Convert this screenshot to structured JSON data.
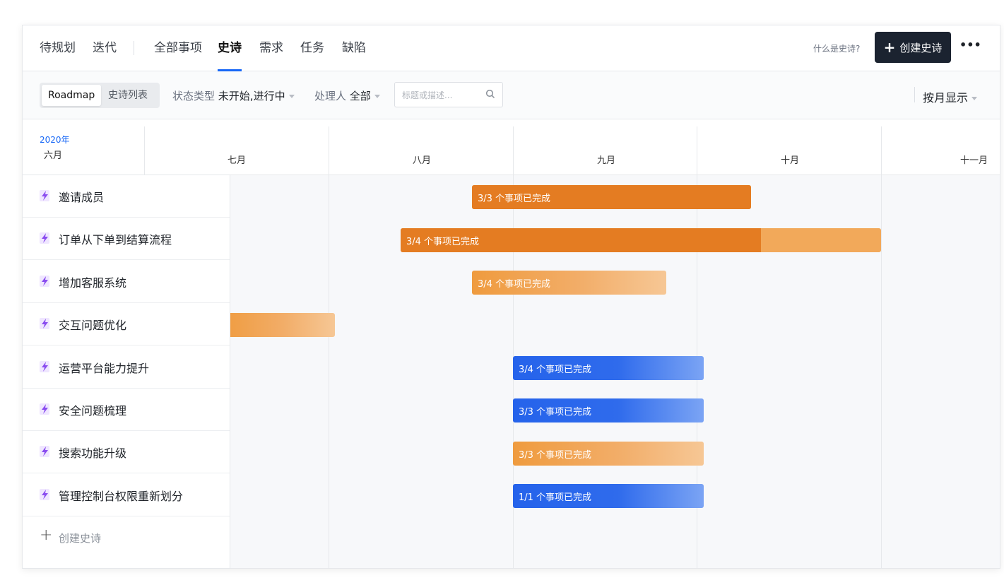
{
  "nav": {
    "tabs": [
      {
        "label": "待规划"
      },
      {
        "label": "迭代"
      },
      {
        "label": "全部事项"
      },
      {
        "label": "史诗"
      },
      {
        "label": "需求"
      },
      {
        "label": "任务"
      },
      {
        "label": "缺陷"
      }
    ],
    "active_tab": "史诗",
    "help_link": "什么是史诗?",
    "create_button": "创建史诗",
    "more_icon": "more-horizontal-icon"
  },
  "filters": {
    "view_toggle": [
      "Roadmap",
      "史诗列表"
    ],
    "active_view": "Roadmap",
    "status_label": "状态类型",
    "status_value": "未开始,进行中",
    "assignee_label": "处理人",
    "assignee_value": "全部",
    "search_placeholder": "标题或描述...",
    "display_mode": "按月显示"
  },
  "timeline": {
    "year": "2020年",
    "months": [
      "六月",
      "七月",
      "八月",
      "九月",
      "十月",
      "十一月"
    ]
  },
  "epics": [
    {
      "title": "邀请成员",
      "progress_text": "3/3 个事项已完成",
      "progress": 1.0,
      "color": "orange"
    },
    {
      "title": "订单从下单到结算流程",
      "progress_text": "3/4 个事项已完成",
      "progress": 0.75,
      "color": "orange"
    },
    {
      "title": "增加客服系统",
      "progress_text": "3/4 个事项已完成",
      "progress": 0.0,
      "color": "orange-light"
    },
    {
      "title": "交互问题优化",
      "progress_text": "",
      "progress": 0.0,
      "color": "orange-light"
    },
    {
      "title": "运营平台能力提升",
      "progress_text": "3/4 个事项已完成",
      "progress": 0.0,
      "color": "blue"
    },
    {
      "title": "安全问题梳理",
      "progress_text": "3/3 个事项已完成",
      "progress": 0.0,
      "color": "blue"
    },
    {
      "title": "搜索功能升级",
      "progress_text": "3/3 个事项已完成",
      "progress": 0.0,
      "color": "orange-light"
    },
    {
      "title": "管理控制台权限重新划分",
      "progress_text": "1/1 个事项已完成",
      "progress": 0.0,
      "color": "blue"
    }
  ],
  "add_epic": "创建史诗",
  "colors": {
    "accent": "#1767f6",
    "orange": "#e47c22",
    "orange_light": "#f2a95a",
    "blue": "#3a73ea",
    "bolt": "#8a4cf0"
  }
}
